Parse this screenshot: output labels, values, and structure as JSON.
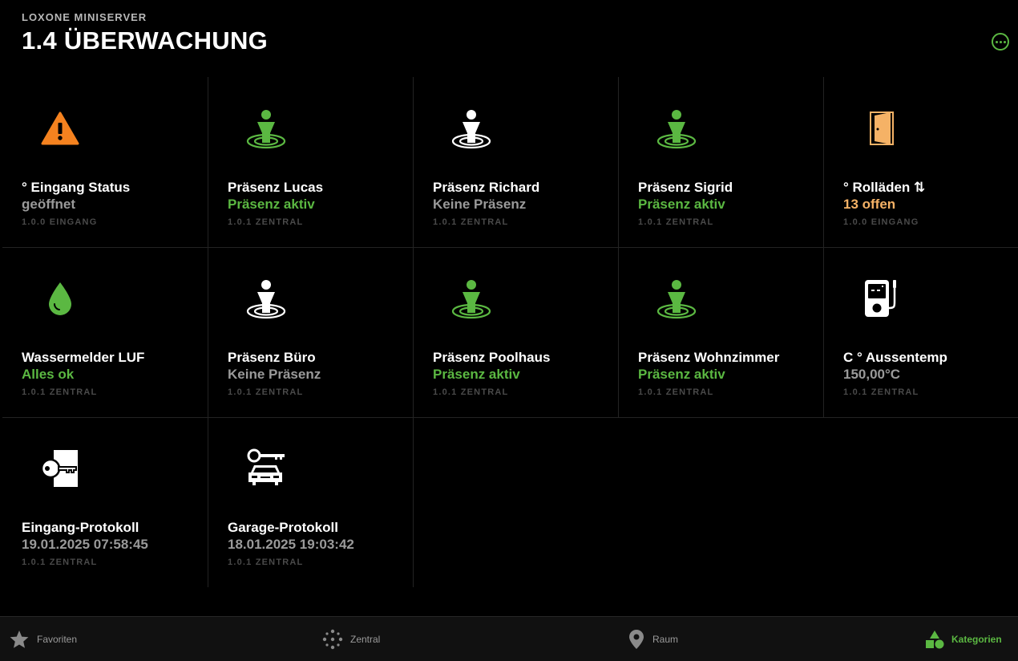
{
  "header": {
    "app_name": "LOXONE MINISERVER",
    "title": "1.4 ÜBERWACHUNG"
  },
  "colors": {
    "green": "#5bb842",
    "orange": "#f5821f",
    "amber": "#f5b266",
    "gray_text": "#9a9a9a",
    "room_text": "#4a4a4a"
  },
  "tiles": [
    {
      "title": "° Eingang Status",
      "value": "geöffnet",
      "room": "1.0.0 EINGANG",
      "icon": "warning-icon"
    },
    {
      "title": "Präsenz Lucas",
      "value": "Präsenz aktiv",
      "room": "1.0.1 ZENTRAL",
      "icon": "presence-icon"
    },
    {
      "title": "Präsenz Richard",
      "value": "Keine Präsenz",
      "room": "1.0.1 ZENTRAL",
      "icon": "presence-icon"
    },
    {
      "title": "Präsenz Sigrid",
      "value": "Präsenz aktiv",
      "room": "1.0.1 ZENTRAL",
      "icon": "presence-icon"
    },
    {
      "title": "° Rolläden ⇅",
      "value": "13 offen",
      "room": "1.0.0 EINGANG",
      "icon": "door-icon"
    },
    {
      "title": "Wassermelder LUF",
      "value": "Alles ok",
      "room": "1.0.1 ZENTRAL",
      "icon": "water-drop-icon"
    },
    {
      "title": "Präsenz Büro",
      "value": "Keine Präsenz",
      "room": "1.0.1 ZENTRAL",
      "icon": "presence-icon"
    },
    {
      "title": "Präsenz Poolhaus",
      "value": "Präsenz aktiv",
      "room": "1.0.1 ZENTRAL",
      "icon": "presence-icon"
    },
    {
      "title": "Präsenz Wohnzimmer",
      "value": "Präsenz aktiv",
      "room": "1.0.1 ZENTRAL",
      "icon": "presence-icon"
    },
    {
      "title": "C ° Aussentemp",
      "value": "150,00°C",
      "room": "1.0.1 ZENTRAL",
      "icon": "thermometer-icon"
    },
    {
      "title": "Eingang-Protokoll",
      "value": "19.01.2025 07:58:45",
      "room": "1.0.1 ZENTRAL",
      "icon": "access-key-icon"
    },
    {
      "title": "Garage-Protokoll",
      "value": "18.01.2025 19:03:42",
      "room": "1.0.1 ZENTRAL",
      "icon": "car-key-icon"
    }
  ],
  "tabbar": [
    {
      "label": "Favoriten",
      "icon": "star-icon",
      "active": false
    },
    {
      "label": "Zentral",
      "icon": "dots-icon",
      "active": false
    },
    {
      "label": "Raum",
      "icon": "map-pin-icon",
      "active": false
    },
    {
      "label": "Kategorien",
      "icon": "shapes-icon",
      "active": true
    }
  ]
}
